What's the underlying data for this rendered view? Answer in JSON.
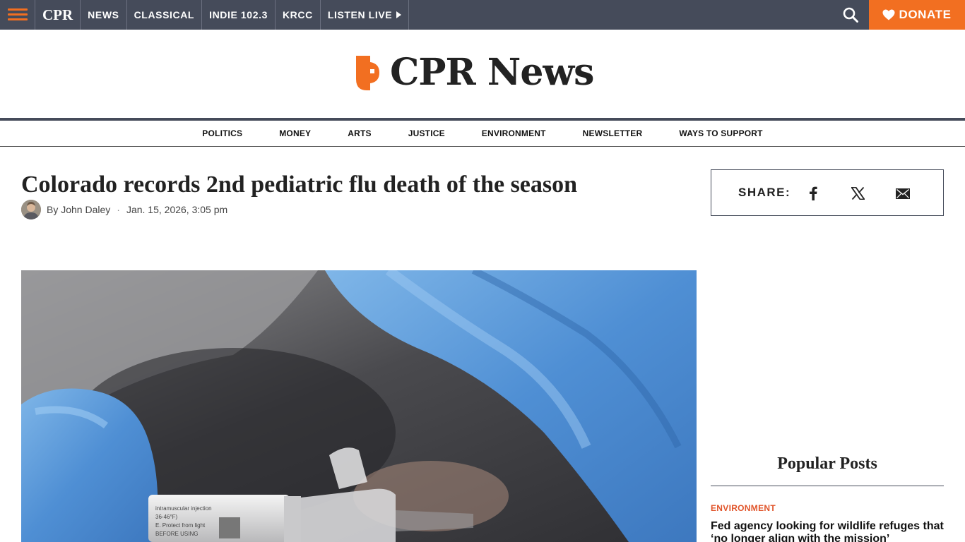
{
  "topbar": {
    "brand": "CPR",
    "nav": [
      "NEWS",
      "CLASSICAL",
      "INDIE 102.3",
      "KRCC",
      "LISTEN LIVE"
    ],
    "donate_label": "DONATE"
  },
  "logo": {
    "text": "CPR News"
  },
  "section_nav": [
    "POLITICS",
    "MONEY",
    "ARTS",
    "JUSTICE",
    "ENVIRONMENT",
    "NEWSLETTER",
    "WAYS TO SUPPORT"
  ],
  "article": {
    "headline": "Colorado records 2nd pediatric flu death of the season",
    "byline_prefix": "By",
    "author": "John Daley",
    "date": "Jan. 15, 2026, 3:05 pm"
  },
  "share": {
    "label": "SHARE:"
  },
  "popular": {
    "title": "Popular Posts",
    "items": [
      {
        "category": "ENVIRONMENT",
        "title": "Fed agency looking for wildlife refuges that ‘no longer align with the mission’"
      }
    ]
  },
  "colors": {
    "accent": "#f26f21",
    "topbar": "#454b5a",
    "category": "#e0542a"
  },
  "icons": [
    "menu-icon",
    "search-icon",
    "heart-icon",
    "play-icon",
    "facebook-icon",
    "x-icon",
    "email-icon"
  ]
}
